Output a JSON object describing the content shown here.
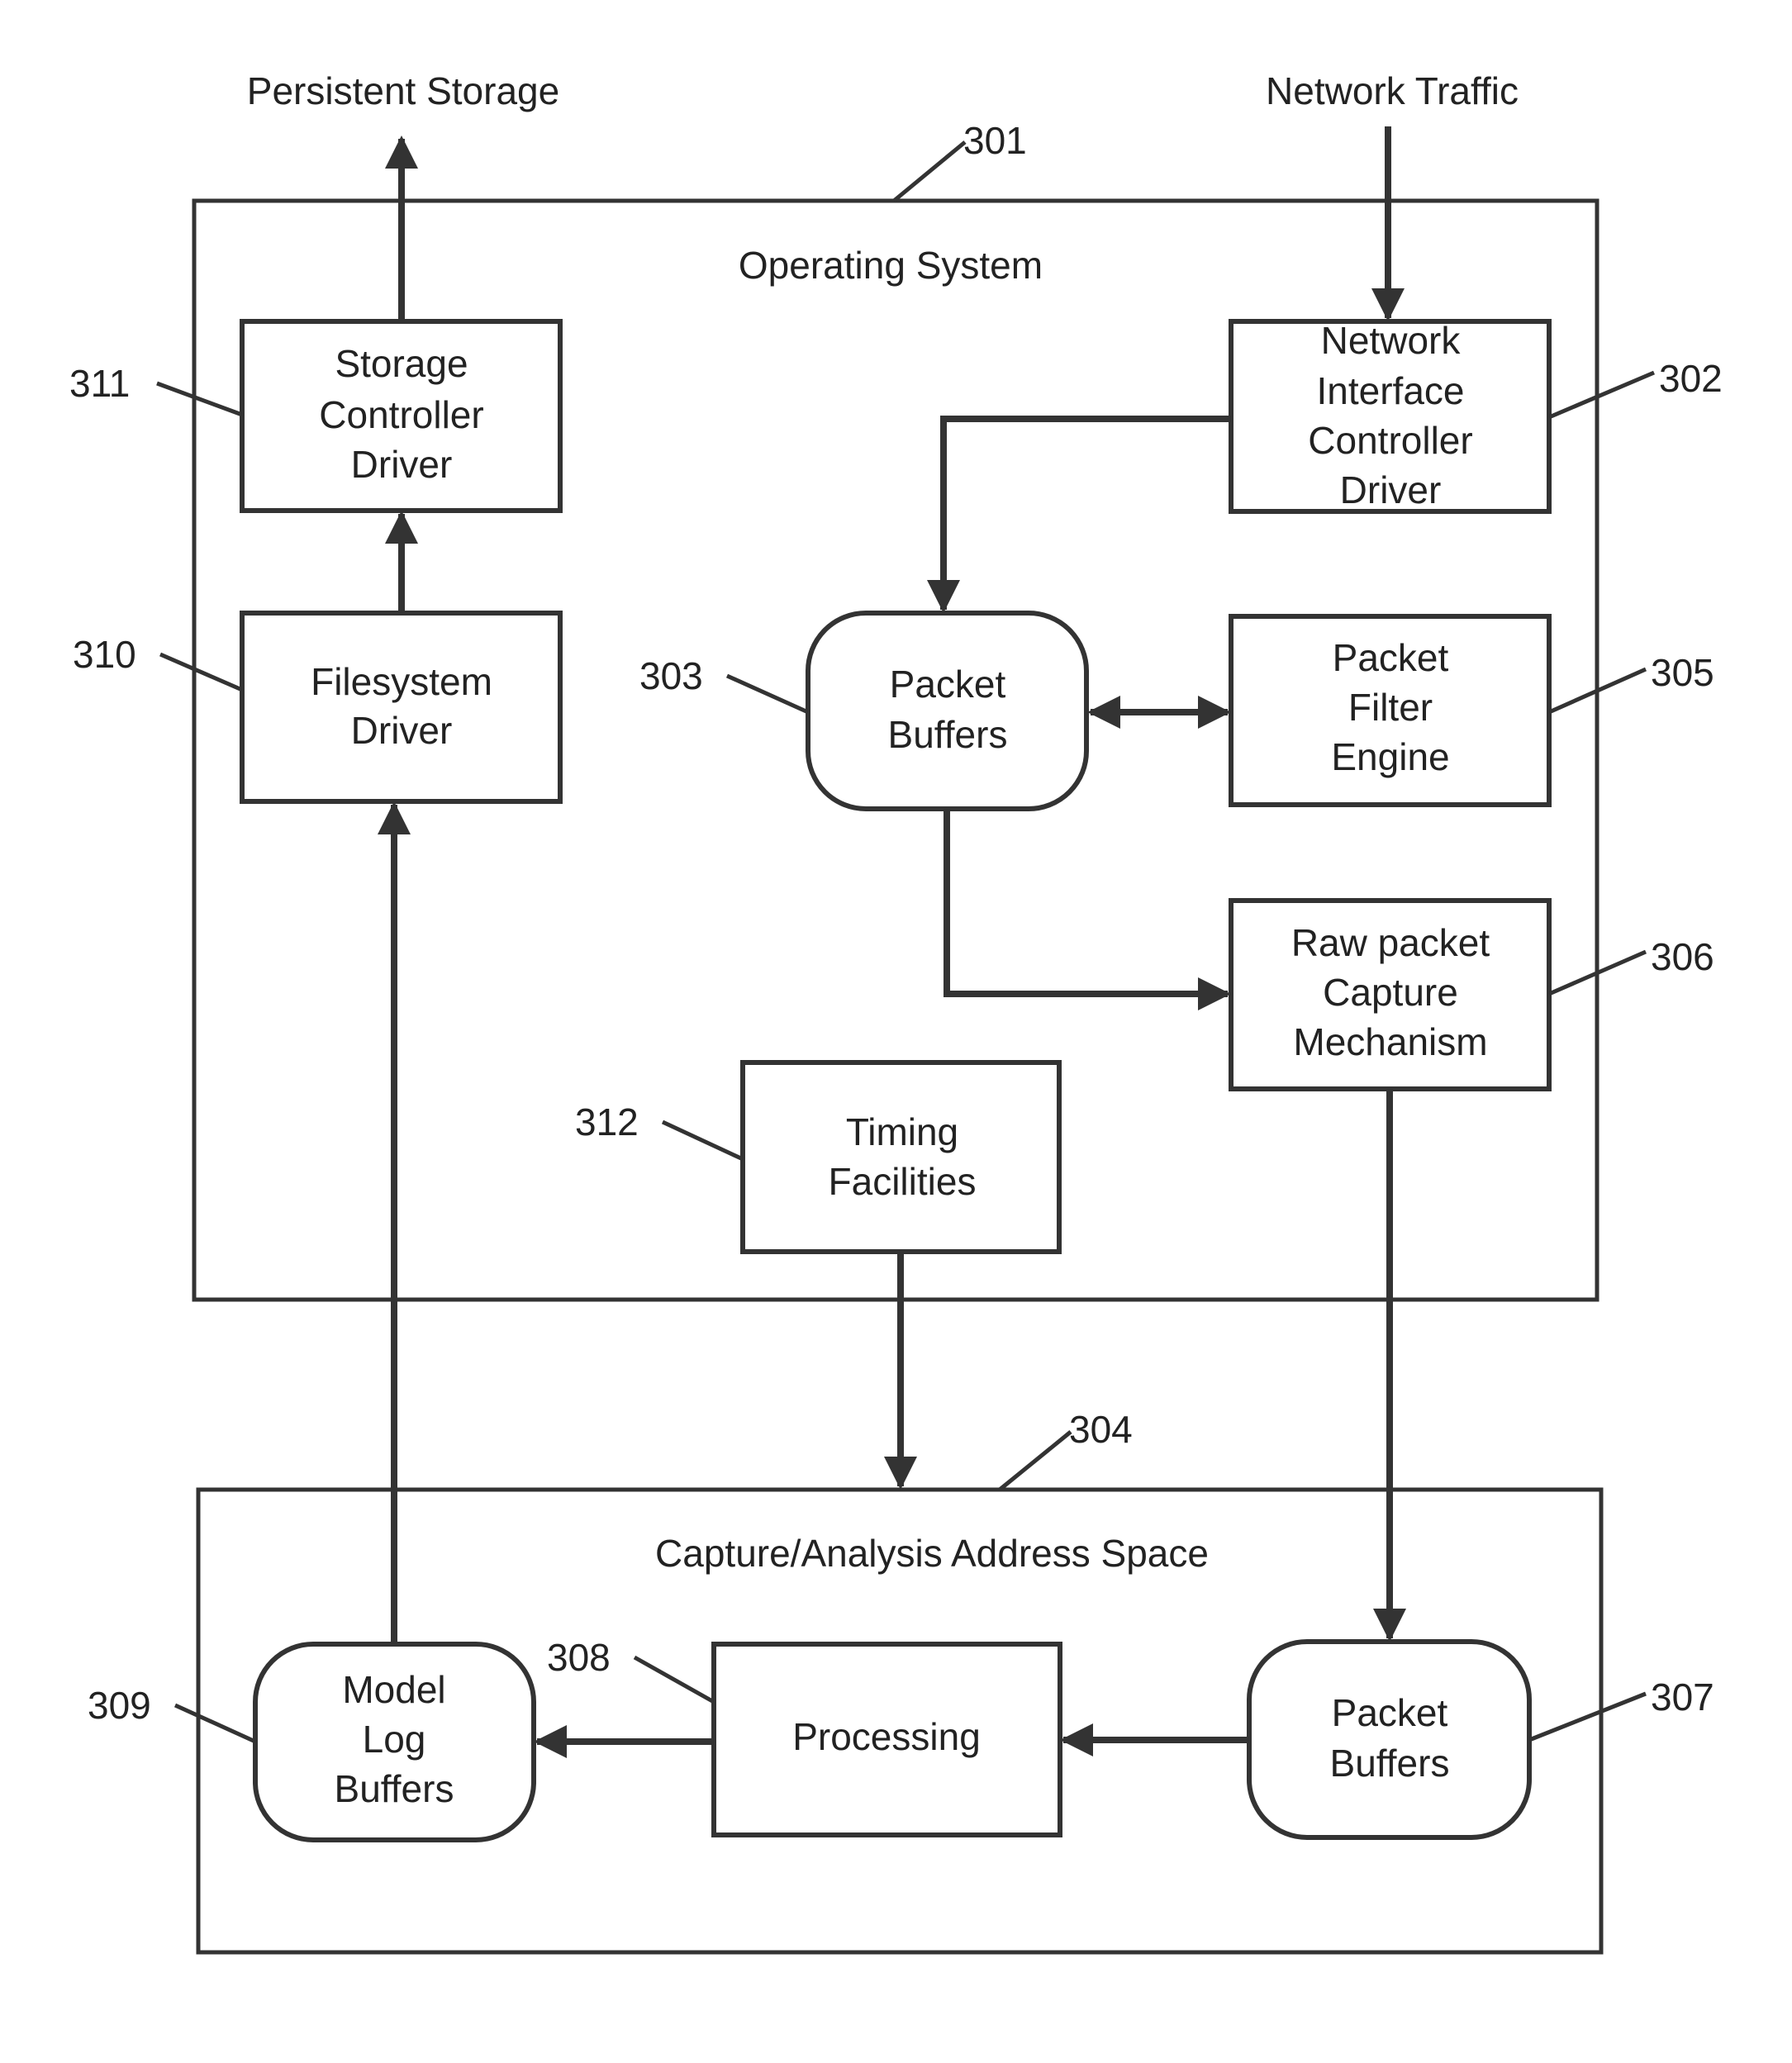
{
  "figure": {
    "external": {
      "persistent_storage": "Persistent Storage",
      "network_traffic": "Network Traffic"
    },
    "containers": [
      {
        "ref": "301",
        "title": "Operating System"
      },
      {
        "ref": "304",
        "title": "Capture/Analysis Address Space"
      }
    ],
    "blocks": {
      "storage_controller": {
        "ref": "311",
        "lines": [
          "Storage",
          "Controller",
          "Driver"
        ],
        "shape": "rectangle"
      },
      "filesystem": {
        "ref": "310",
        "lines": [
          "Filesystem",
          "Driver"
        ],
        "shape": "rectangle"
      },
      "nic_driver": {
        "ref": "302",
        "lines": [
          "Network",
          "Interface",
          "Controller",
          "Driver"
        ],
        "shape": "rectangle"
      },
      "packet_buffers_os": {
        "ref": "303",
        "lines": [
          "Packet",
          "Buffers"
        ],
        "shape": "rounded"
      },
      "packet_filter": {
        "ref": "305",
        "lines": [
          "Packet",
          "Filter",
          "Engine"
        ],
        "shape": "rectangle"
      },
      "raw_capture": {
        "ref": "306",
        "lines": [
          "Raw packet",
          "Capture",
          "Mechanism"
        ],
        "shape": "rectangle"
      },
      "timing": {
        "ref": "312",
        "lines": [
          "Timing",
          "Facilities"
        ],
        "shape": "rectangle"
      },
      "model_log": {
        "ref": "309",
        "lines": [
          "Model",
          "Log",
          "Buffers"
        ],
        "shape": "rounded"
      },
      "processing": {
        "ref": "308",
        "lines": [
          "Processing"
        ],
        "shape": "rectangle"
      },
      "packet_buffers_capture": {
        "ref": "307",
        "lines": [
          "Packet",
          "Buffers"
        ],
        "shape": "rounded"
      }
    },
    "edges": [
      {
        "from": "storage_controller",
        "to": "persistent_storage"
      },
      {
        "from": "filesystem",
        "to": "storage_controller"
      },
      {
        "from": "network_traffic",
        "to": "nic_driver"
      },
      {
        "from": "nic_driver",
        "to": "packet_buffers_os"
      },
      {
        "from": "packet_buffers_os",
        "to": "packet_filter",
        "bidirectional": true
      },
      {
        "from": "packet_buffers_os",
        "to": "raw_capture"
      },
      {
        "from": "raw_capture",
        "to": "packet_buffers_capture"
      },
      {
        "from": "timing",
        "to": "capture_analysis_space"
      },
      {
        "from": "packet_buffers_capture",
        "to": "processing"
      },
      {
        "from": "processing",
        "to": "model_log"
      },
      {
        "from": "model_log",
        "to": "filesystem"
      }
    ]
  }
}
